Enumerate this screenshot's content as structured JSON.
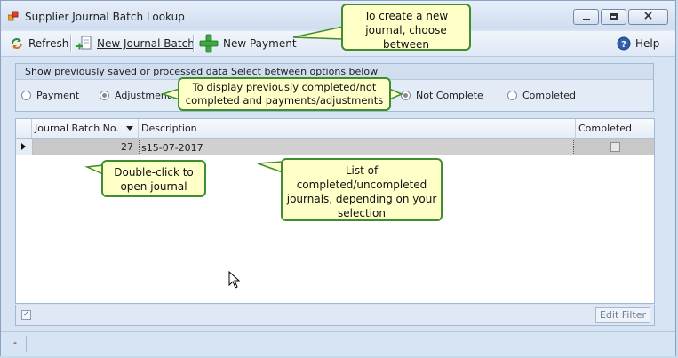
{
  "window": {
    "title": "Supplier Journal Batch Lookup",
    "minimize_glyph": "",
    "close_glyph": "×"
  },
  "toolbar": {
    "refresh_label": "Refresh",
    "refresh_icon": "refresh-icon",
    "new_journal_batch_label": "New Journal Batch",
    "new_journal_batch_icon": "new-document-icon",
    "new_payment_label": "New Payment",
    "new_payment_icon": "green-plus-icon",
    "help_label": "Help",
    "help_icon": "help-icon"
  },
  "filter": {
    "caption": "Show previously saved or processed data Select between options below",
    "type_options": [
      {
        "label": "Payment",
        "checked": false
      },
      {
        "label": "Adjustment",
        "checked": true
      }
    ],
    "status_options": [
      {
        "label": "Not Complete",
        "checked": true
      },
      {
        "label": "Completed",
        "checked": false
      }
    ]
  },
  "grid": {
    "columns": [
      "Journal Batch No.",
      "Description",
      "Completed"
    ],
    "rows": [
      {
        "batch_no": "27",
        "description": "s15-07-2017",
        "completed": false
      }
    ],
    "footer_checked": true,
    "edit_filter_label": "Edit Filter"
  },
  "status": {
    "text": "-"
  },
  "callouts": {
    "new_journal": "To create a new journal, choose between",
    "display_previous": "To display previously completed/not completed and payments/adjustments",
    "double_click": "Double-click to open journal",
    "list_desc": "List of completed/uncompleted journals, depending on your selection"
  },
  "colors": {
    "callout_bg": "#ffffc8",
    "callout_border": "#3e8d2f",
    "row_selected": "#c8c8c8",
    "window_bg": "#d6e3f3"
  }
}
